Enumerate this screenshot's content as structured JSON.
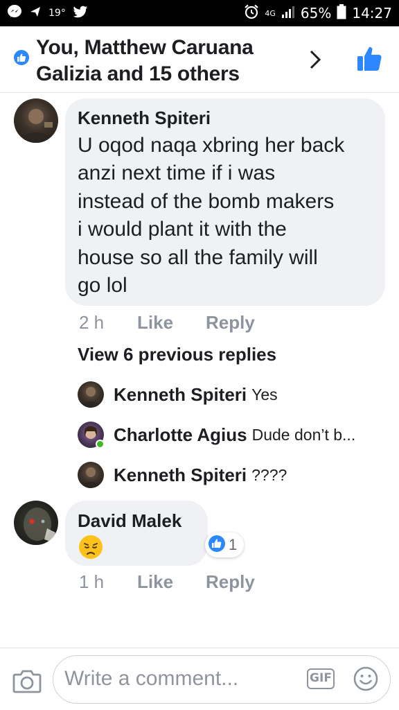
{
  "status_bar": {
    "temperature": "19°",
    "network": "4G",
    "battery": "65%",
    "time": "14:27"
  },
  "header": {
    "likers": "You, Matthew Caruana Galizia and 15 others"
  },
  "comments": [
    {
      "author": "Kenneth Spiteri",
      "lines": [
        "U oqod naqa xbring her back",
        "anzi next time if i was",
        "instead of the bomb makers",
        "i would plant it with the",
        "house so all the family will",
        "go lol"
      ],
      "time": "2 h",
      "like_label": "Like",
      "reply_label": "Reply",
      "view_replies": "View 6 previous replies",
      "replies": [
        {
          "author": "Kenneth Spiteri",
          "text": "Yes"
        },
        {
          "author": "Charlotte Agius",
          "text": "Dude don’t b..."
        },
        {
          "author": "Kenneth Spiteri",
          "text": "????"
        }
      ]
    },
    {
      "author": "David Malek",
      "emoji": "disappointed-face",
      "reaction_count": "1",
      "time": "1 h",
      "like_label": "Like",
      "reply_label": "Reply"
    }
  ],
  "composer": {
    "placeholder": "Write a comment...",
    "gif_label": "GIF"
  },
  "colors": {
    "facebook_blue": "#2d88ff",
    "bubble": "#eff1f4",
    "meta_gray": "#8d949e",
    "online_green": "#42b72a"
  }
}
